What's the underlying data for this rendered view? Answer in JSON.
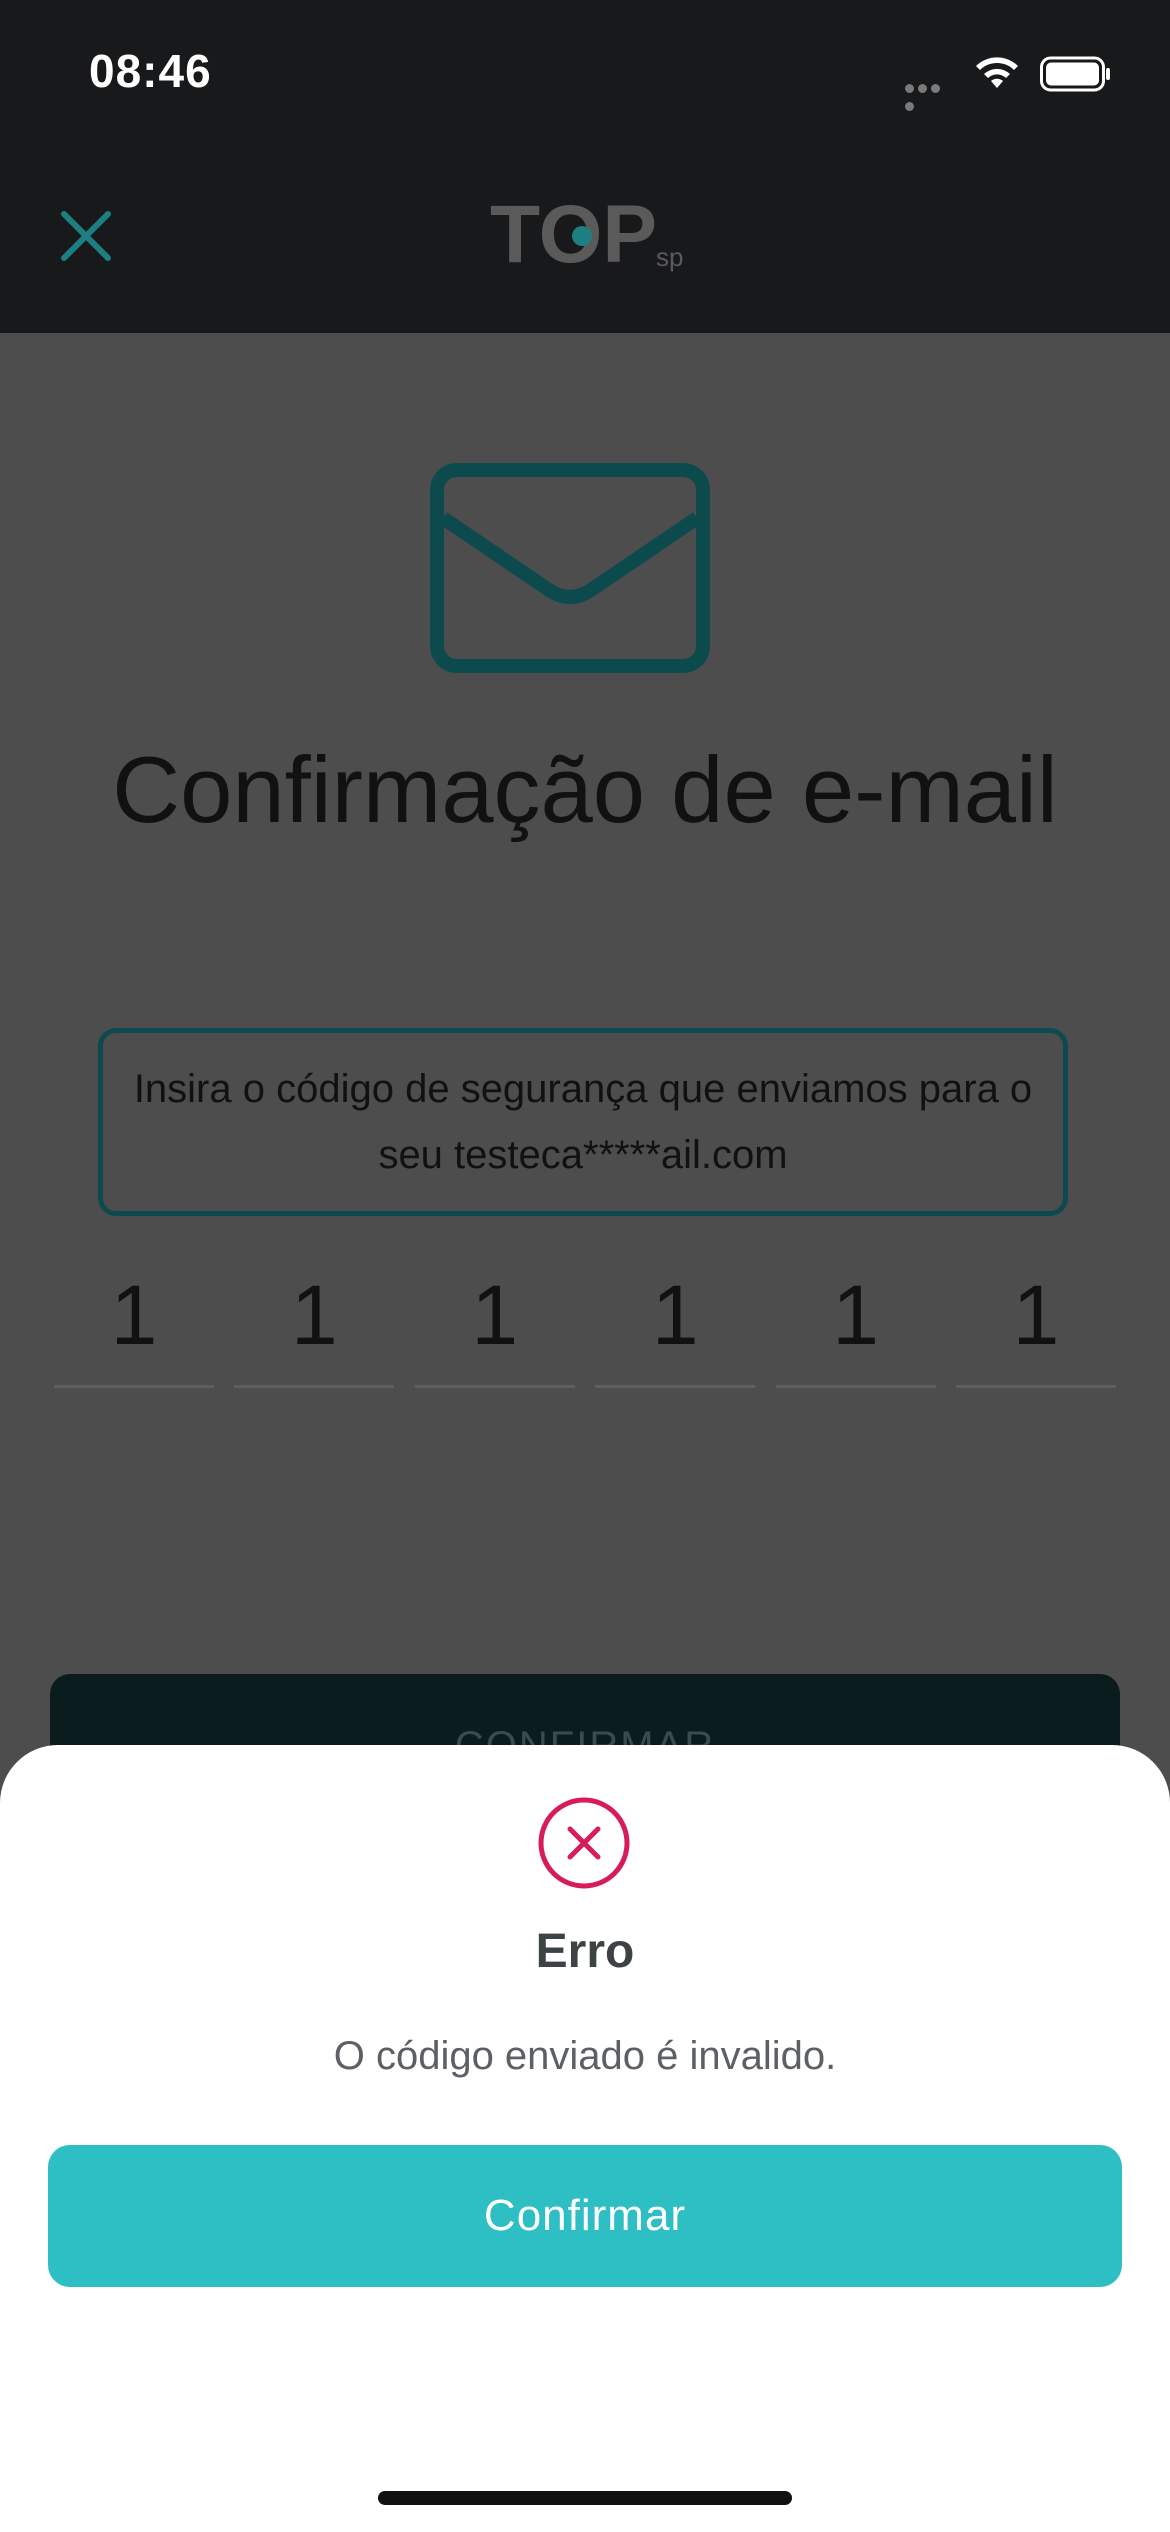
{
  "status_bar": {
    "time": "08:46"
  },
  "header": {
    "close_icon": "close-icon",
    "logo_text": "TOP",
    "logo_sub": "sp"
  },
  "content": {
    "icon": "envelope-icon",
    "title": "Confirmação de e-mail",
    "info": "Insira o código de segurança que enviamos para o seu testeca*****ail.com",
    "code_digits": [
      "1",
      "1",
      "1",
      "1",
      "1",
      "1"
    ],
    "confirm_button_label": "CONFIRMAR"
  },
  "dialog": {
    "icon": "error-circle-icon",
    "title": "Erro",
    "message": "O código enviado é invalido.",
    "button_label": "Confirmar"
  },
  "colors": {
    "accent": "#2dbfc4",
    "error": "#d81b5c",
    "teal_dark": "#0d4a4e"
  }
}
